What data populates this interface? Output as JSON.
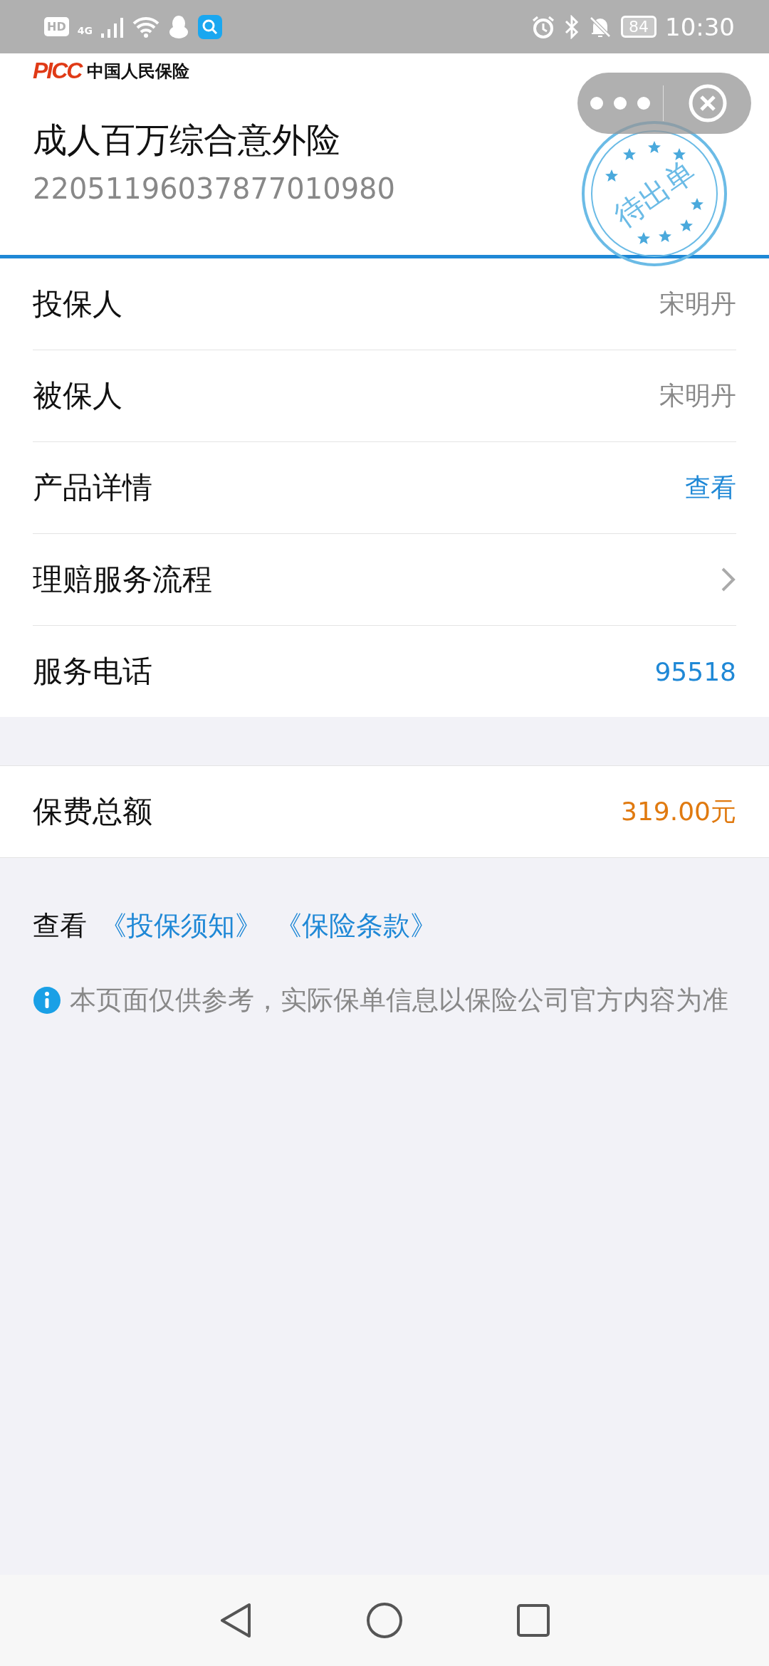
{
  "status_bar": {
    "hd": "HD",
    "network": "4G",
    "battery": "84",
    "time": "10:30"
  },
  "header": {
    "logo_mark": "PICC",
    "logo_name": "中国人民保险",
    "title": "成人百万综合意外险",
    "policy_number": "22051196037877010980",
    "stamp": "待出单"
  },
  "info_rows": [
    {
      "label": "投保人",
      "value": "宋明丹",
      "kind": "value"
    },
    {
      "label": "被保人",
      "value": "宋明丹",
      "kind": "value"
    },
    {
      "label": "产品详情",
      "value": "查看",
      "kind": "link"
    },
    {
      "label": "理赔服务流程",
      "kind": "chevron"
    },
    {
      "label": "服务电话",
      "value": "95518",
      "kind": "link"
    }
  ],
  "total_row": {
    "label": "保费总额",
    "value": "319.00元",
    "kind": "amount"
  },
  "documents": {
    "prefix": "查看",
    "links": [
      "《投保须知》",
      "《保险条款》"
    ]
  },
  "notice": "本页面仅供参考，实际保单信息以保险公司官方内容为准"
}
